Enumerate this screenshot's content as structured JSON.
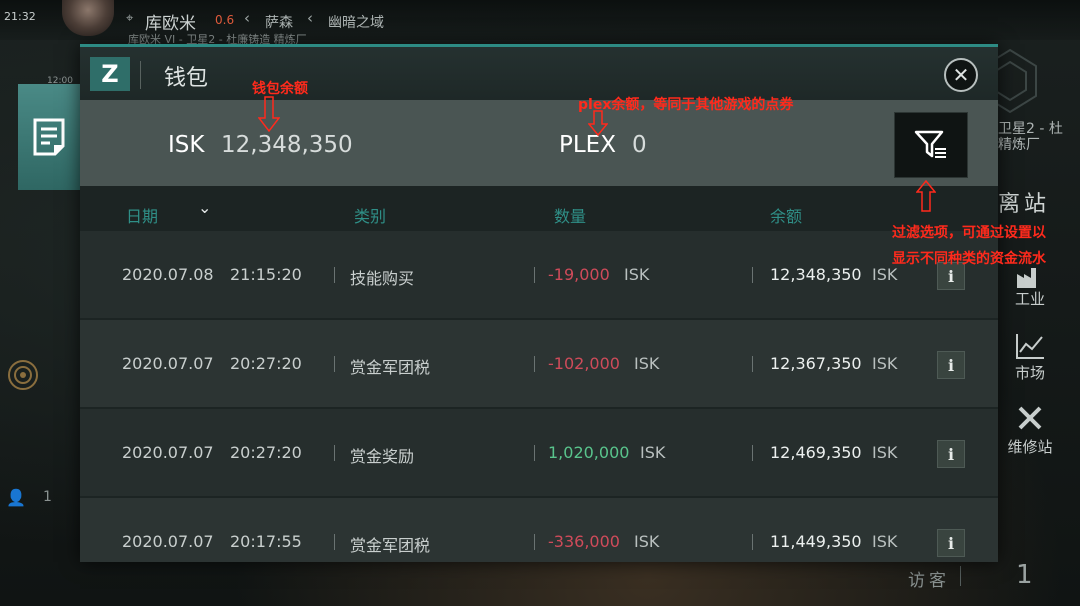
{
  "status_bar": {
    "time": "21:32",
    "time_small": "12:00"
  },
  "location": {
    "system": "库欧米",
    "security": "0.6",
    "region": "萨森",
    "constellation": "幽暗之域",
    "station": "库欧米 VI - 卫星2 - 杜廉铸造 精炼厂"
  },
  "right_panel": {
    "station_line1": "卫星2 - 杜",
    "station_line2": "精炼厂",
    "undock": "离站",
    "items": [
      {
        "label": "工业",
        "icon": "factory-icon"
      },
      {
        "label": "市场",
        "icon": "chart-icon"
      },
      {
        "label": "维修站",
        "icon": "wrench-icon"
      }
    ],
    "visitor_label": "访客",
    "visitor_count": "1"
  },
  "left_panel": {
    "pilot_count": "1",
    "active_icon": "document-icon"
  },
  "wallet": {
    "logo": "Z",
    "title": "钱包",
    "isk_label": "ISK",
    "isk_balance": "12,348,350",
    "plex_label": "PLEX",
    "plex_balance": "0",
    "columns": {
      "date": "日期",
      "type": "类别",
      "amount": "数量",
      "balance": "余额"
    },
    "sort_icon": "chevron-down-icon",
    "transactions": [
      {
        "date": "2020.07.08",
        "time": "21:15:20",
        "type": "技能购买",
        "amount": "-19,000",
        "amount_sign": "negative",
        "currency": "ISK",
        "balance": "12,348,350",
        "balance_currency": "ISK"
      },
      {
        "date": "2020.07.07",
        "time": "20:27:20",
        "type": "赏金军团税",
        "amount": "-102,000",
        "amount_sign": "negative",
        "currency": "ISK",
        "balance": "12,367,350",
        "balance_currency": "ISK"
      },
      {
        "date": "2020.07.07",
        "time": "20:27:20",
        "type": "赏金奖励",
        "amount": "1,020,000",
        "amount_sign": "positive",
        "currency": "ISK",
        "balance": "12,469,350",
        "balance_currency": "ISK"
      },
      {
        "date": "2020.07.07",
        "time": "20:17:55",
        "type": "赏金军团税",
        "amount": "-336,000",
        "amount_sign": "negative",
        "currency": "ISK",
        "balance": "11,449,350",
        "balance_currency": "ISK"
      }
    ]
  },
  "annotations": {
    "wallet_balance": "钱包余额",
    "plex_balance": "plex余额，等同于其他游戏的点券",
    "filter_line1": "过滤选项，可通过设置以",
    "filter_line2": "显示不同种类的资金流水"
  },
  "colors": {
    "accent": "#2d8b84",
    "negative": "#cf4b5a",
    "positive": "#59c48c",
    "annotation": "#ff2a1c"
  }
}
